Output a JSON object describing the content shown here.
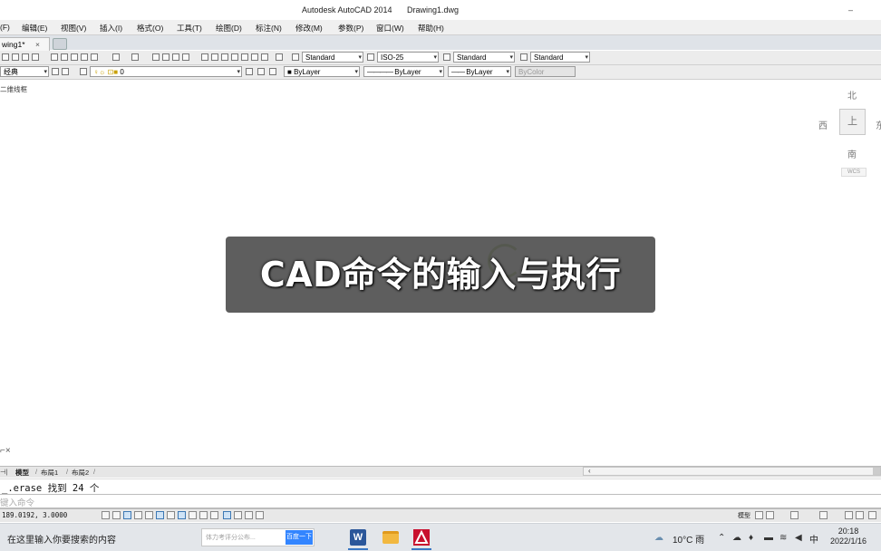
{
  "window": {
    "app_title": "Autodesk AutoCAD 2014",
    "file_title": "Drawing1.dwg"
  },
  "menu": {
    "items": [
      "(F)",
      "编辑(E)",
      "视图(V)",
      "插入(I)",
      "格式(O)",
      "工具(T)",
      "绘图(D)",
      "标注(N)",
      "修改(M)",
      "参数(P)",
      "窗口(W)",
      "帮助(H)"
    ]
  },
  "file_tabs": {
    "active_label": "wing1*",
    "close_glyph": "×"
  },
  "toolbar1": {
    "text_style": "Standard",
    "dim_style": "ISO-25",
    "table_style": "Standard",
    "multileader_style": "Standard"
  },
  "toolbar2": {
    "workspace": "经典",
    "layer": "0",
    "color": "ByLayer",
    "linetype": "ByLayer",
    "lineweight": "ByLayer",
    "plot_style": "ByColor"
  },
  "viewport": {
    "view_label": "二维线框",
    "compass": {
      "north": "北",
      "south": "南",
      "west": "西",
      "east": "东",
      "top": "上"
    },
    "wcs_label": "WCS",
    "overlay_caption": "CAD命令的输入与执行"
  },
  "layout_tabs": [
    "模型",
    "布局1",
    "布局2"
  ],
  "command": {
    "history": "_.erase 找到 24 个",
    "prompt_placeholder": "键入命令"
  },
  "status": {
    "coordinates": "189.0192, 3.0000",
    "model_label": "模型"
  },
  "taskbar": {
    "search_text": "在这里输入你要搜索的内容",
    "baidu_placeholder": "体力考评分公布...",
    "baidu_button": "百度一下",
    "weather": "10°C 雨",
    "ime": "中",
    "time": "20:18",
    "date": "2022/1/16"
  }
}
